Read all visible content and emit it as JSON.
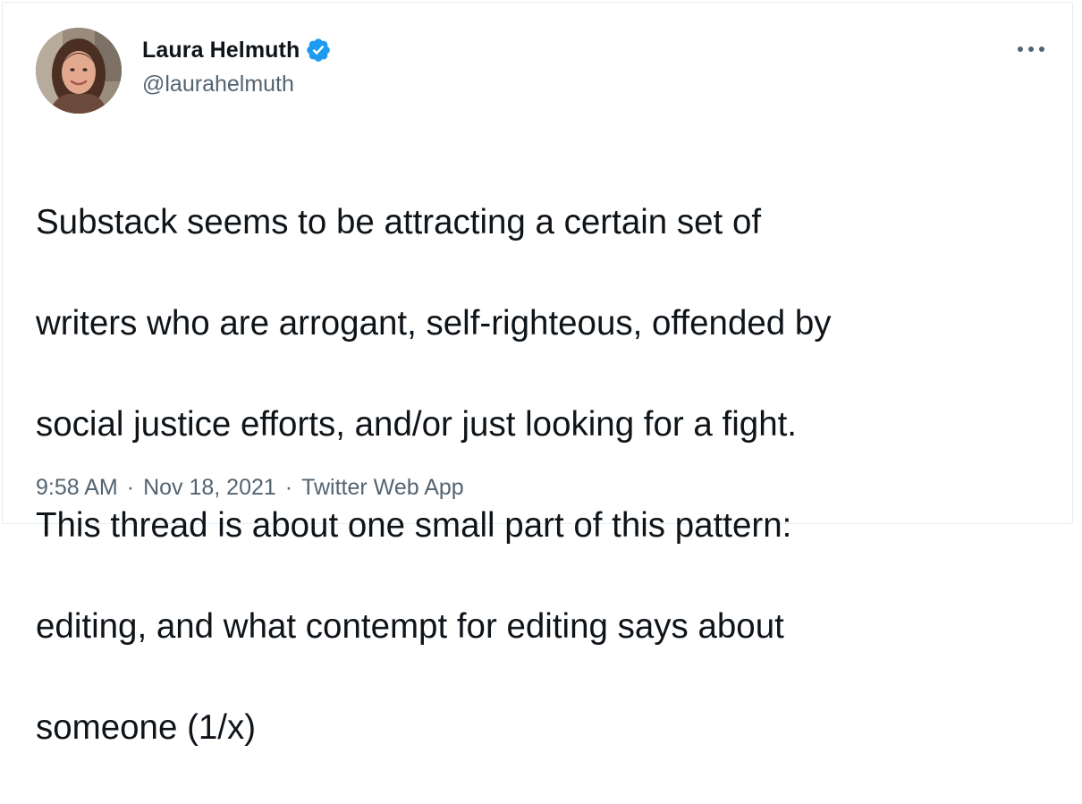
{
  "tweet": {
    "author": {
      "display_name": "Laura Helmuth",
      "handle": "@laurahelmuth",
      "verified": true,
      "avatar_icon": "profile-photo"
    },
    "text_lines": [
      "Substack seems to be attracting a certain set of",
      "writers who are arrogant, self-righteous, offended by",
      "social justice efforts, and/or just looking for a fight.",
      "This thread is about one small part of this pattern:",
      "editing, and what contempt for editing says about",
      "someone (1/x)"
    ],
    "time": "9:58 AM",
    "separator": "·",
    "date": "Nov 18, 2021",
    "source": "Twitter Web App",
    "more_icon": "more-options-icon"
  },
  "colors": {
    "text_primary": "#0f1419",
    "text_secondary": "#536471",
    "verified_blue": "#1d9bf0",
    "border": "#e6ecf0"
  }
}
